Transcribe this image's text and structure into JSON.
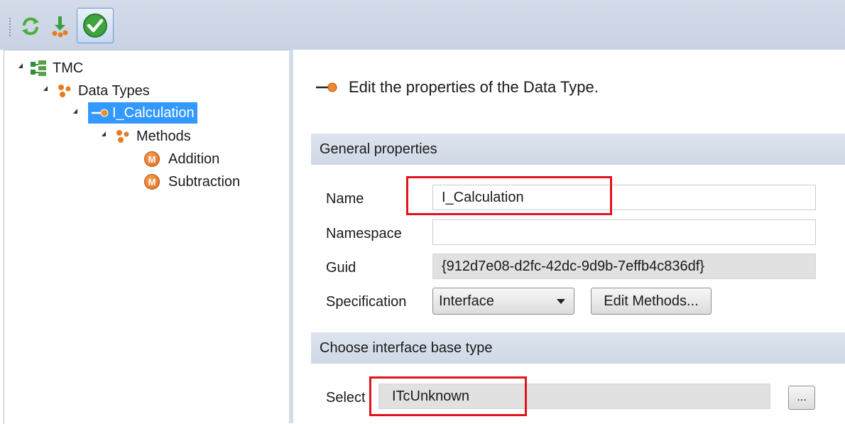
{
  "toolbar": {
    "buttons": [
      {
        "icon": "refresh-icon"
      },
      {
        "icon": "download-icon"
      },
      {
        "icon": "checkmark-icon"
      }
    ]
  },
  "tree": {
    "root": "TMC",
    "data_types": "Data Types",
    "selected": "I_Calculation",
    "methods": "Methods",
    "method_items": [
      "Addition",
      "Subtraction"
    ],
    "method_icon_letter": "M"
  },
  "main": {
    "heading": "Edit the properties of the Data Type.",
    "general_section": "General properties",
    "name_label": "Name",
    "name_value": "I_Calculation",
    "namespace_label": "Namespace",
    "namespace_value": "",
    "guid_label": "Guid",
    "guid_value": "{912d7e08-d2fc-42dc-9d9b-7effb4c836df}",
    "spec_label": "Specification",
    "spec_value": "Interface",
    "edit_methods": "Edit Methods...",
    "base_section": "Choose interface base type",
    "select_label": "Select",
    "select_value": "ITcUnknown",
    "browse_button": "..."
  },
  "colors": {
    "selection": "#3399ff",
    "highlight_box": "#e1141e",
    "method_icon": "#e06a18"
  }
}
